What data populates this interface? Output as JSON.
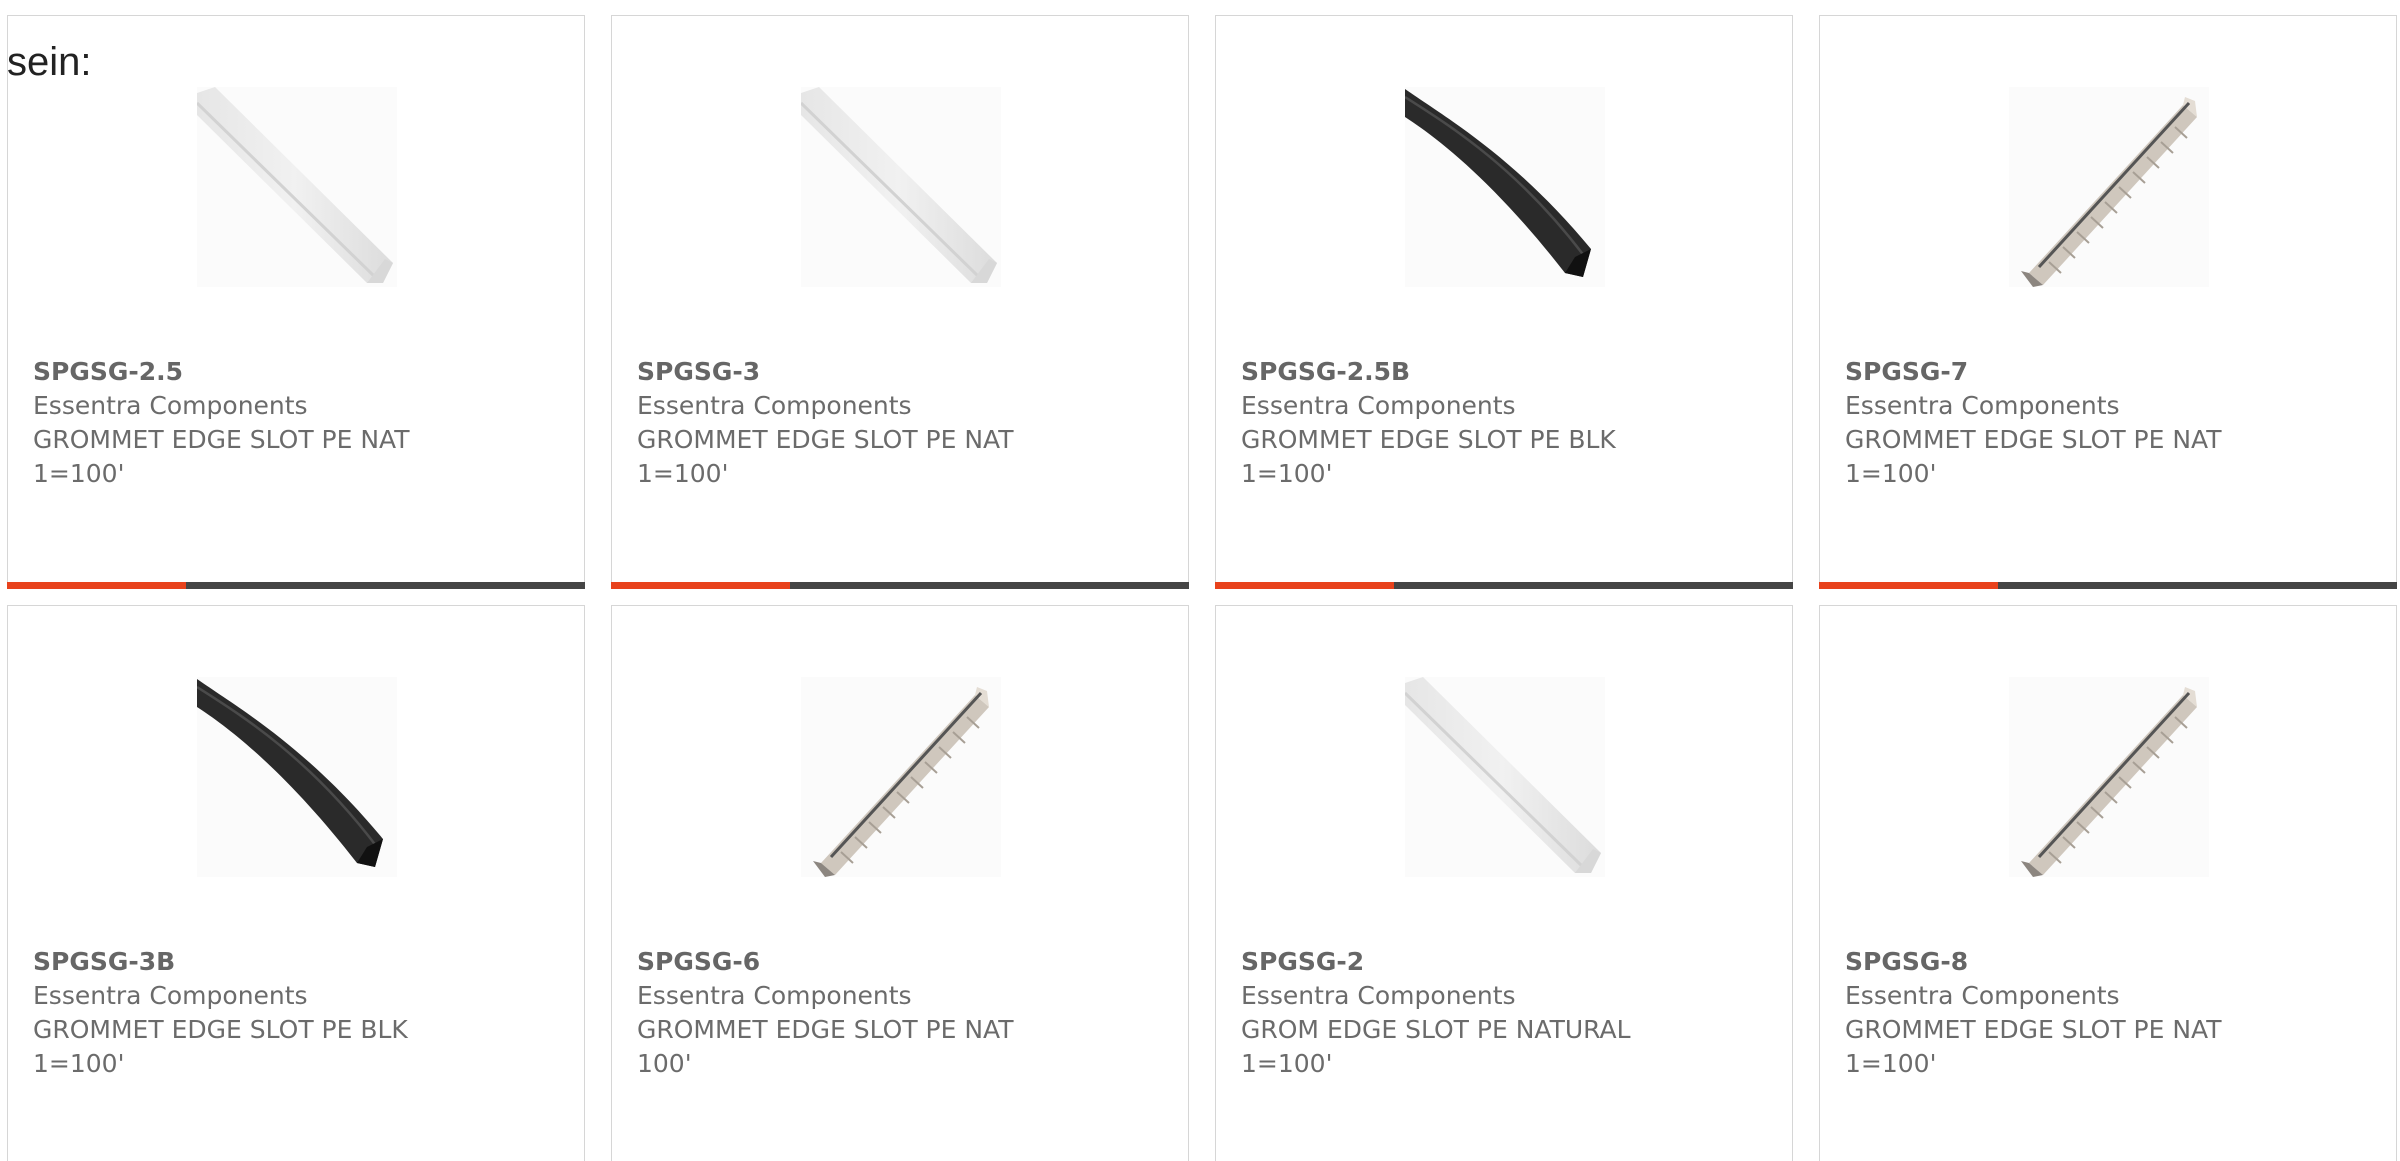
{
  "page": {
    "stray_text": "sein:"
  },
  "colors": {
    "accent": "#e8421c",
    "track": "#454545",
    "card_border": "#d6d6d6"
  },
  "products": [
    {
      "part_number": "SPGSG-2.5",
      "manufacturer": "Essentra Components",
      "description": "GROMMET EDGE SLOT PE NAT",
      "packaging": "1=100'",
      "image_icon": "natural-grommet-strip-icon",
      "progress": 0.31
    },
    {
      "part_number": "SPGSG-3",
      "manufacturer": "Essentra Components",
      "description": "GROMMET EDGE SLOT PE NAT",
      "packaging": "1=100'",
      "image_icon": "natural-grommet-strip-icon",
      "progress": 0.31
    },
    {
      "part_number": "SPGSG-2.5B",
      "manufacturer": "Essentra Components",
      "description": "GROMMET EDGE SLOT PE BLK",
      "packaging": "1=100'",
      "image_icon": "black-grommet-strip-icon",
      "progress": 0.31
    },
    {
      "part_number": "SPGSG-7",
      "manufacturer": "Essentra Components",
      "description": "GROMMET EDGE SLOT PE NAT",
      "packaging": "1=100'",
      "image_icon": "ribbed-grommet-strip-icon",
      "progress": 0.31
    },
    {
      "part_number": "SPGSG-3B",
      "manufacturer": "Essentra Components",
      "description": "GROMMET EDGE SLOT PE BLK",
      "packaging": "1=100'",
      "image_icon": "black-grommet-strip-icon"
    },
    {
      "part_number": "SPGSG-6",
      "manufacturer": "Essentra Components",
      "description": "GROMMET EDGE SLOT PE NAT",
      "packaging": "100'",
      "image_icon": "ribbed-grommet-strip-icon"
    },
    {
      "part_number": "SPGSG-2",
      "manufacturer": "Essentra Components",
      "description": "GROM EDGE SLOT PE NATURAL",
      "packaging": "1=100'",
      "image_icon": "natural-grommet-strip-icon"
    },
    {
      "part_number": "SPGSG-8",
      "manufacturer": "Essentra Components",
      "description": "GROMMET EDGE SLOT PE NAT",
      "packaging": "1=100'",
      "image_icon": "ribbed-grommet-strip-icon"
    }
  ]
}
